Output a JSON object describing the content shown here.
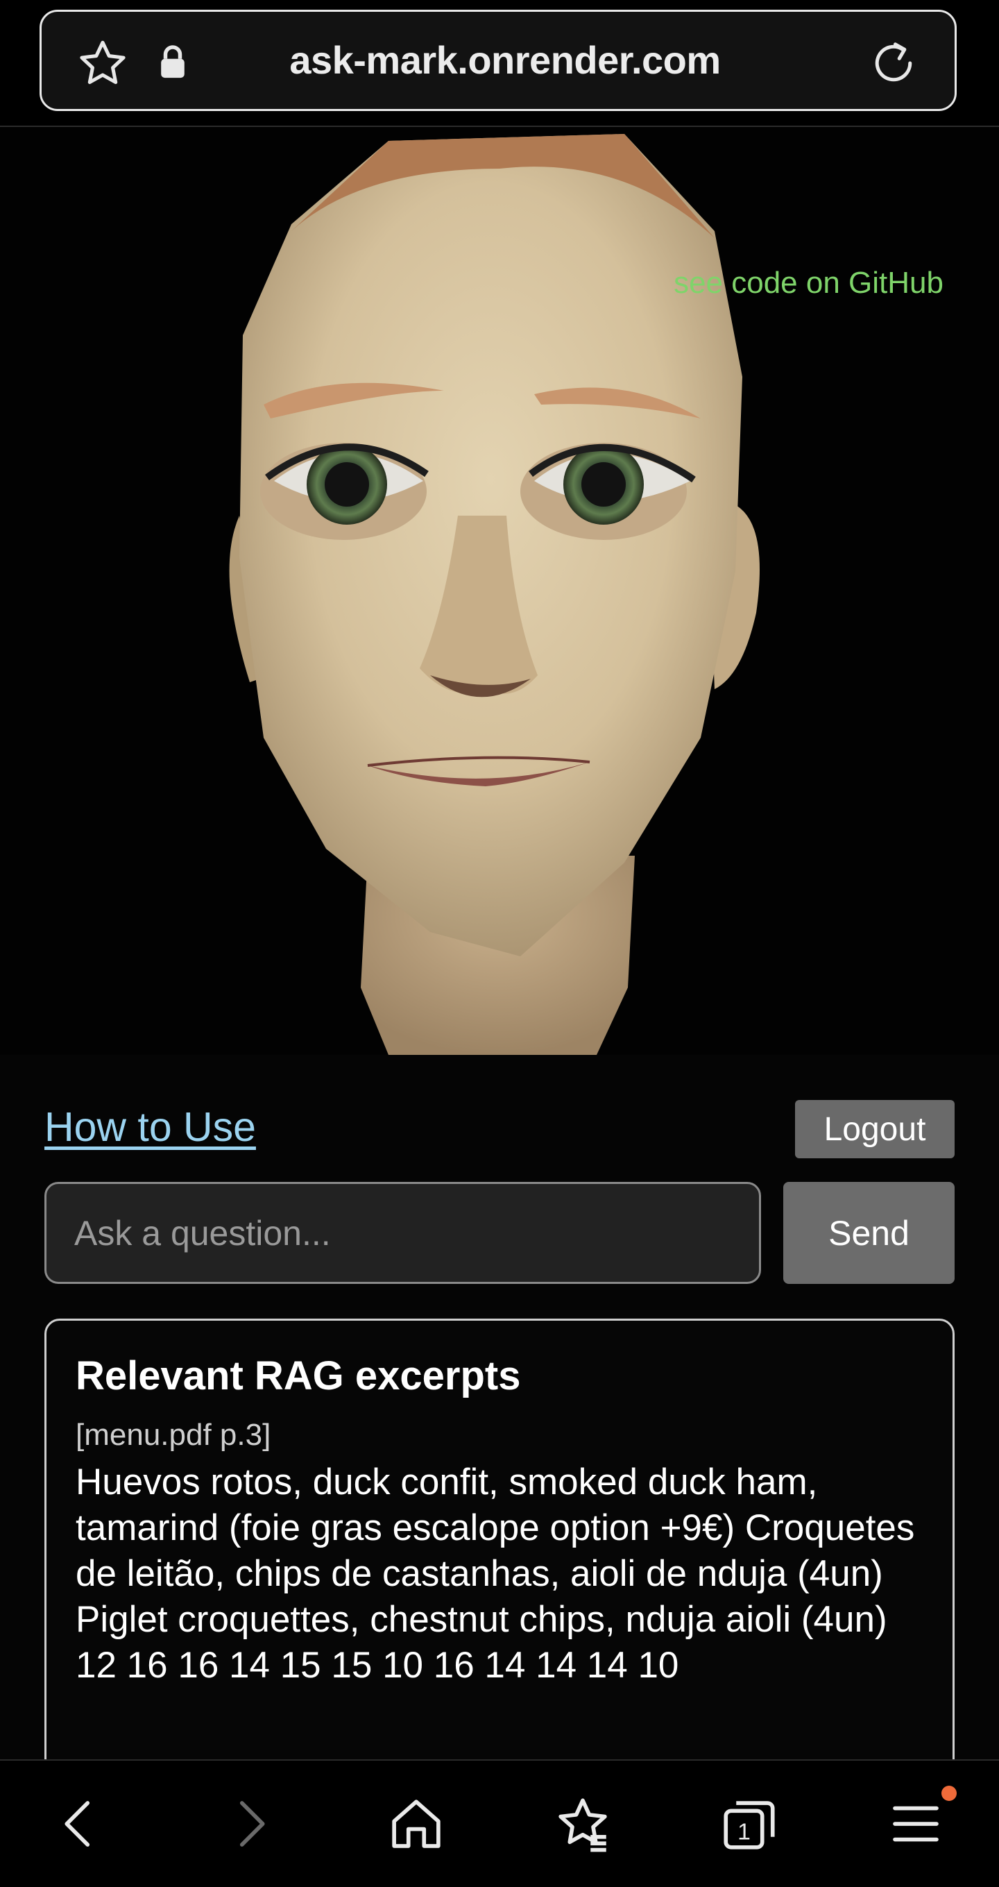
{
  "browser": {
    "url": "ask-mark.onrender.com"
  },
  "stage": {
    "github_link": "see code on GitHub"
  },
  "controls": {
    "how_to_use": "How to Use",
    "logout": "Logout",
    "question_placeholder": "Ask a question...",
    "send": "Send"
  },
  "rag": {
    "title": "Relevant RAG excerpts",
    "excerpts": [
      {
        "source": "[menu.pdf p.3]",
        "text": "Huevos rotos, duck confit, smoked duck ham, tamarind (foie gras escalope option +9€) Croquetes de leitão, chips de castanhas, aioli de nduja (4un) Piglet croquettes, chestnut chips, nduja aioli (4un) 12 16 16 14 15 15 10 16 14 14 14 10"
      }
    ]
  },
  "colors": {
    "link": "#9bd3f0",
    "github": "#7fd46a",
    "button": "#6a6a6a",
    "notification_dot": "#ef6b3a"
  },
  "icons": [
    "star-icon",
    "lock-icon",
    "reload-icon",
    "back-icon",
    "forward-icon",
    "home-icon",
    "bookmarks-icon",
    "tabs-icon",
    "menu-icon"
  ]
}
